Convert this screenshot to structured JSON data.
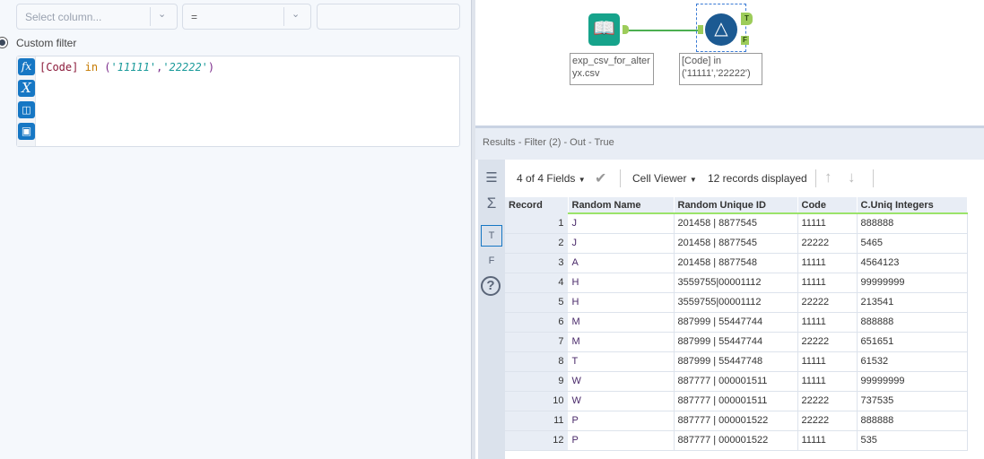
{
  "filter": {
    "column_placeholder": "Select column...",
    "operator": "=",
    "value": "",
    "custom_label": "Custom filter",
    "expression": {
      "field": "[Code]",
      "keyword": "in",
      "open": "(",
      "s1": "'11111'",
      "comma": ",",
      "s2": "'22222'",
      "close": ")"
    }
  },
  "editor_icons": [
    "fx-icon",
    "variable-icon",
    "open-folder-icon",
    "save-icon"
  ],
  "canvas": {
    "input_label": "exp_csv_for_alter yx.csv",
    "filter_label": "[Code] in ('11111','22222')",
    "true_anchor": "T",
    "false_anchor": "F"
  },
  "results": {
    "title": "Results - Filter (2) - Out - True",
    "fields": "4 of 4 Fields",
    "viewer": "Cell Viewer",
    "records": "12 records displayed",
    "side_t": "T",
    "side_f": "F",
    "side_help": "?",
    "columns": [
      "Record",
      "Random Name",
      "Random Unique ID",
      "Code",
      "C.Uniq Integers"
    ],
    "rows": [
      [
        "1",
        "J",
        "201458 | 8877545",
        "11111",
        "888888"
      ],
      [
        "2",
        "J",
        "201458 | 8877545",
        "22222",
        "5465"
      ],
      [
        "3",
        "A",
        "201458 | 8877548",
        "11111",
        "4564123"
      ],
      [
        "4",
        "H",
        "3559755|00001112",
        "11111",
        "99999999"
      ],
      [
        "5",
        "H",
        "3559755|00001112",
        "22222",
        "213541"
      ],
      [
        "6",
        "M",
        "887999 | 55447744",
        "11111",
        "888888"
      ],
      [
        "7",
        "M",
        "887999 | 55447744",
        "22222",
        "651651"
      ],
      [
        "8",
        "T",
        "887999 | 55447748",
        "11111",
        "61532"
      ],
      [
        "9",
        "W",
        "887777 | 000001511",
        "11111",
        "99999999"
      ],
      [
        "10",
        "W",
        "887777 | 000001511",
        "22222",
        "737535"
      ],
      [
        "11",
        "P",
        "887777 | 000001522",
        "22222",
        "888888"
      ],
      [
        "12",
        "P",
        "887777 | 000001522",
        "11111",
        "535"
      ]
    ]
  }
}
